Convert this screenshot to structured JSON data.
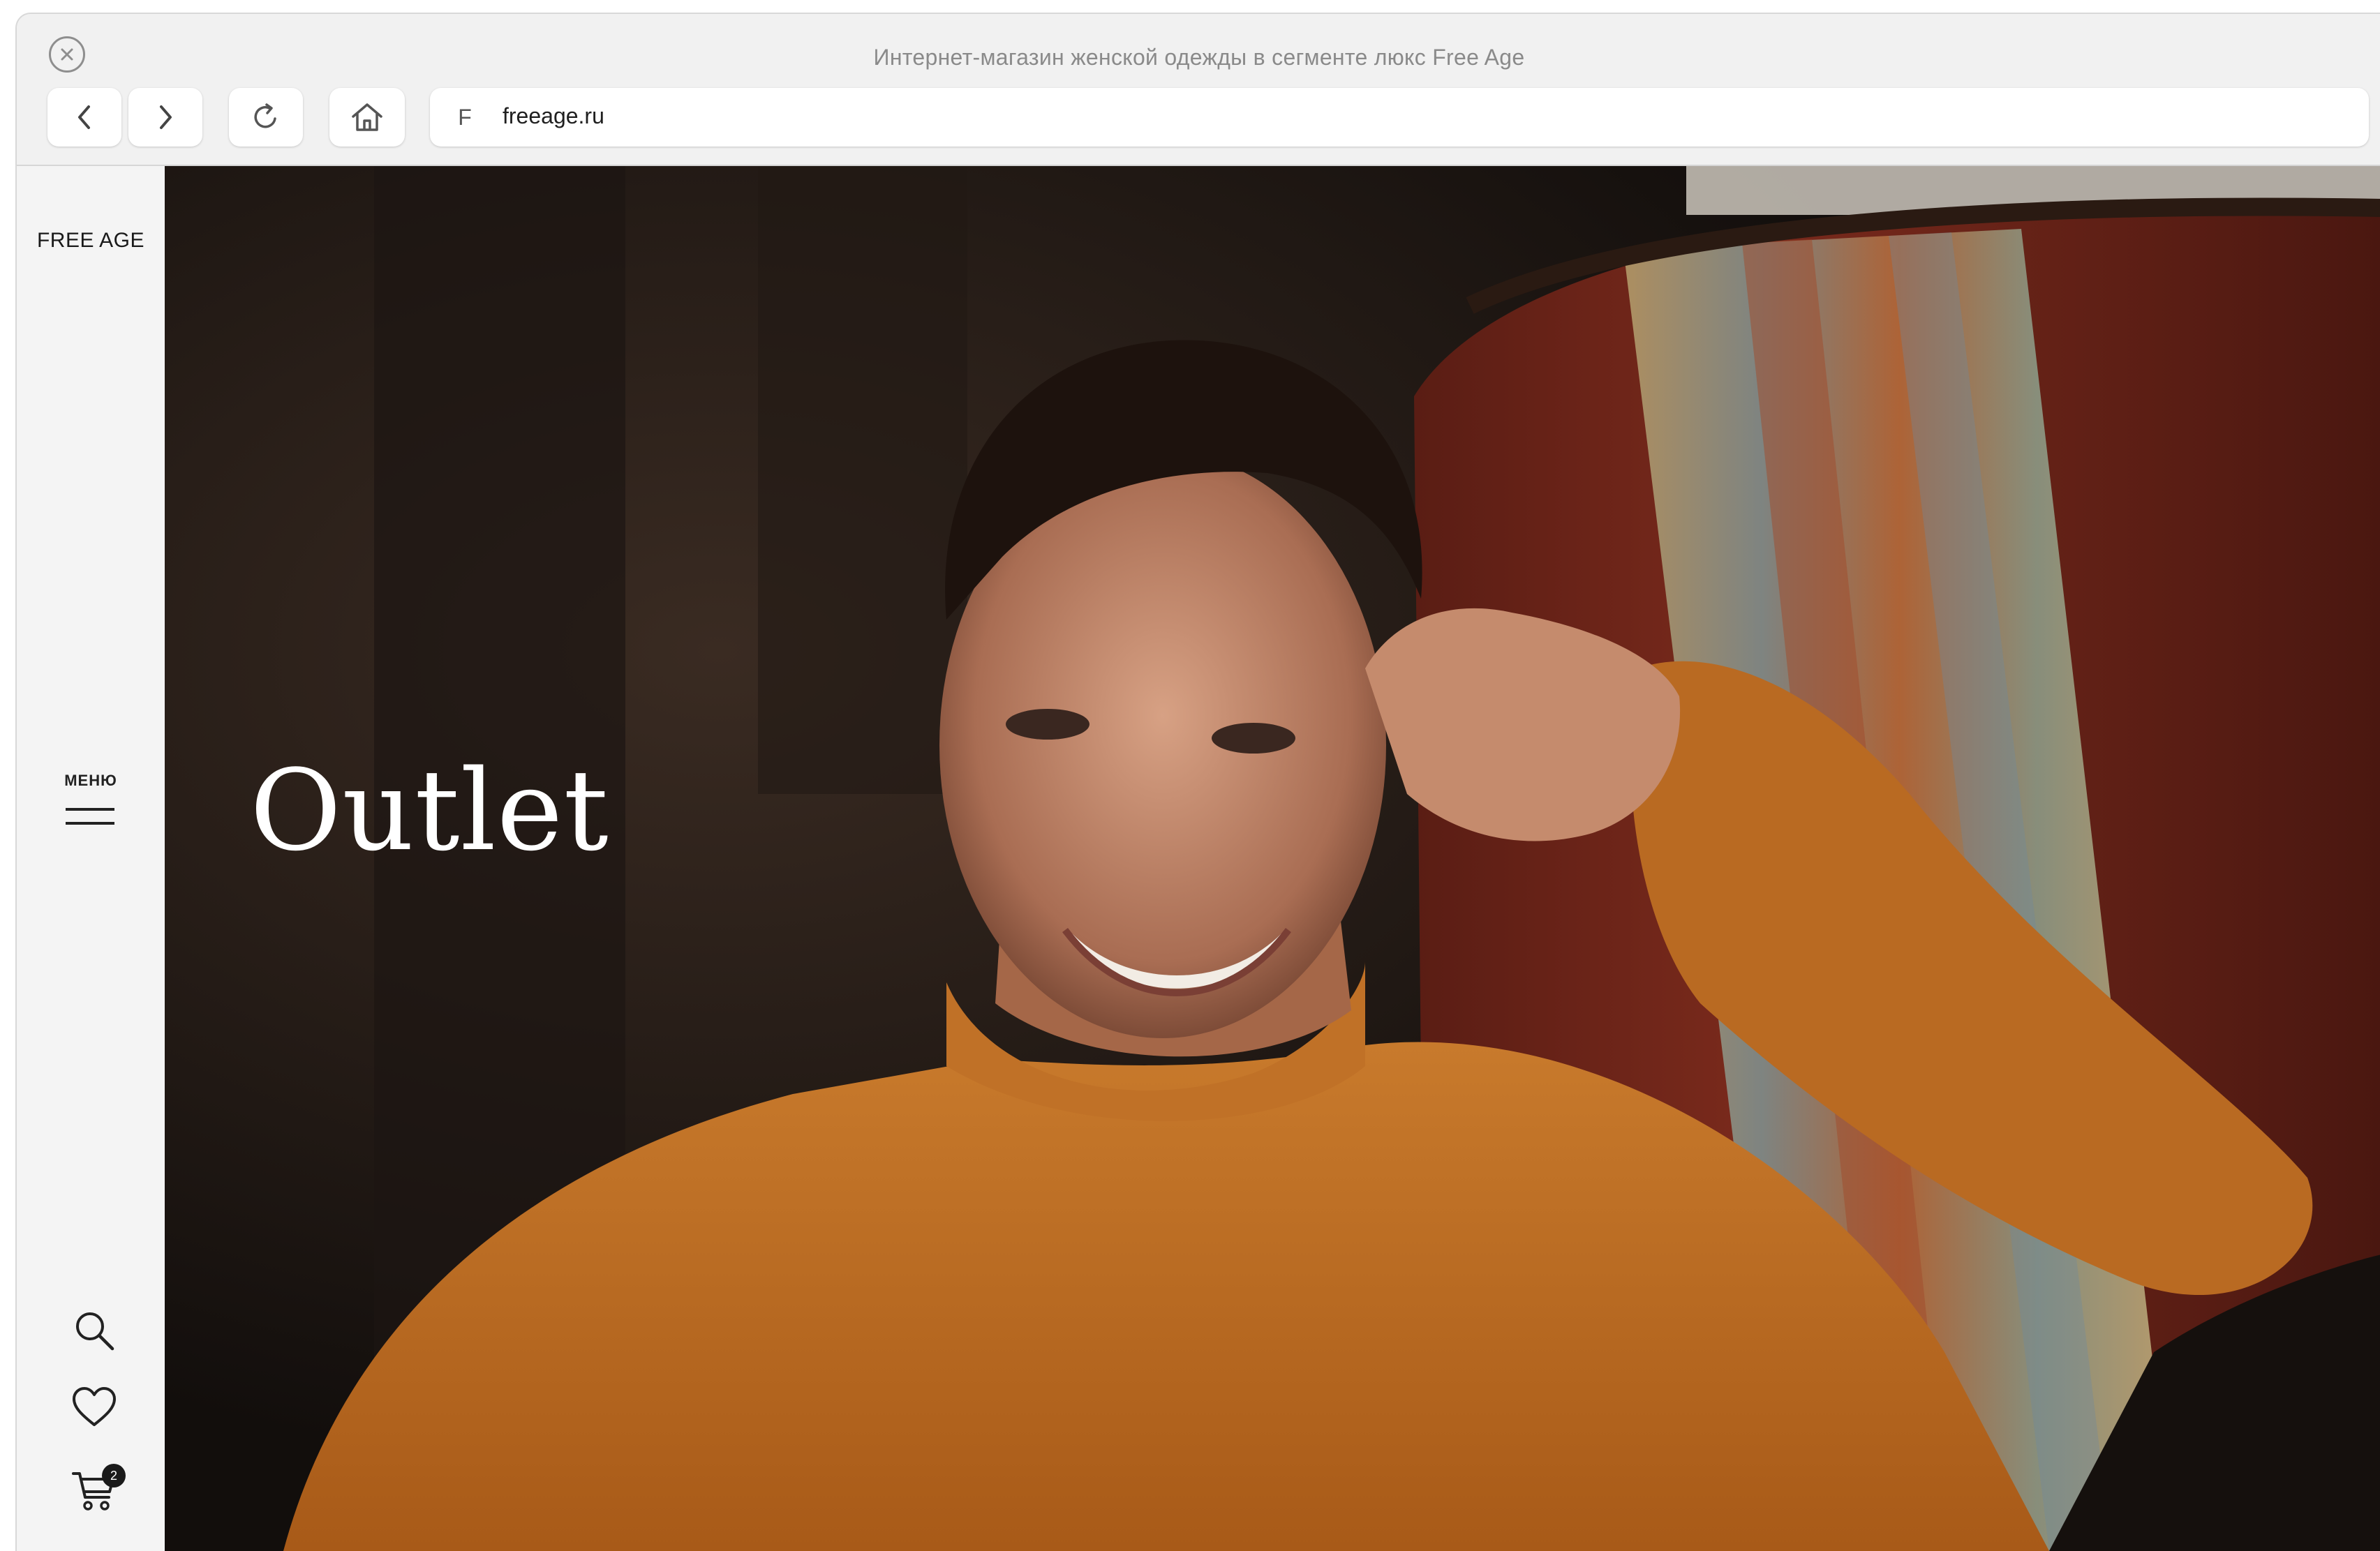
{
  "browser": {
    "window_title": "Интернет-магазин женской одежды в сегменте люкс Free Age",
    "favicon_letter": "F",
    "url": "freeage.ru"
  },
  "sidebar": {
    "logo": "FREE AGE",
    "menu_label": "МЕНЮ",
    "cart_count": "2",
    "icons": [
      "search-icon",
      "heart-icon",
      "cart-icon"
    ]
  },
  "hero": {
    "title": "Outlet"
  },
  "colors": {
    "accent_sweater": "#b8641c",
    "hero_dark": "#1a1512",
    "chair_red": "#6e2318"
  }
}
